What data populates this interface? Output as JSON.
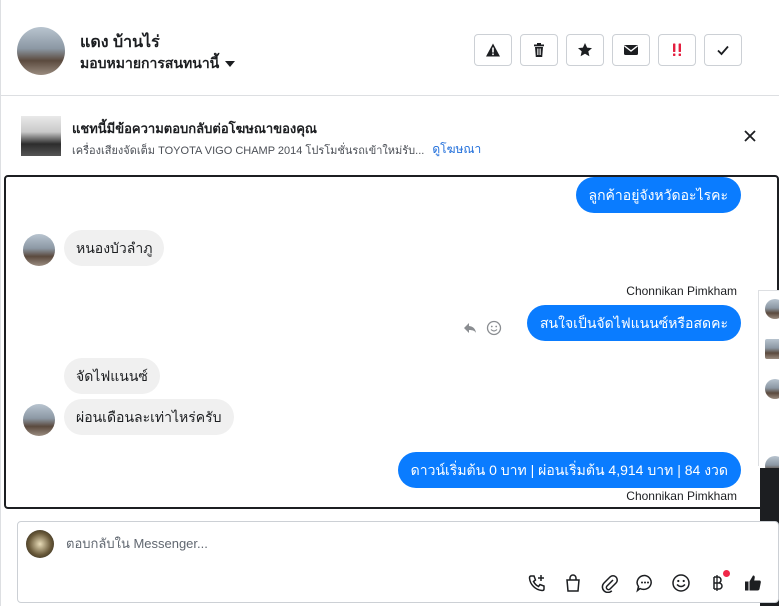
{
  "contact": {
    "name": "แดง บ้านไร่",
    "assign_label": "มอบหมายการสนทนานี้"
  },
  "header_actions": [
    {
      "icon": "warning-icon"
    },
    {
      "icon": "trash-icon"
    },
    {
      "icon": "star-icon"
    },
    {
      "icon": "envelope-icon"
    },
    {
      "icon": "double-exclamation-icon"
    },
    {
      "icon": "checkmark-icon"
    }
  ],
  "ad_banner": {
    "title": "แชทนี้มีข้อความตอบกลับต่อโฆษณาของคุณ",
    "subtitle": "เครื่องเสียงจัดเต็ม TOYOTA VIGO CHAMP 2014 โปรโมชั่นรถเข้าใหม่รับ...",
    "link": "ดูโฆษณา"
  },
  "messages": [
    {
      "direction": "out",
      "text": "ลูกค้าอยู่จังหวัดอะไรคะ"
    },
    {
      "direction": "in",
      "text": "หนองบัวลำภู"
    },
    {
      "direction": "out",
      "sender": "Chonnikan Pimkham",
      "text": "สนใจเป็นจัดไฟแนนซ์หรือสดคะ"
    },
    {
      "direction": "in",
      "text": "จัดไฟแนนซ์"
    },
    {
      "direction": "in",
      "text": "ผ่อนเดือนละเท่าไหร่ครับ"
    },
    {
      "direction": "out",
      "text": "ดาวน์เริ่มต้น 0 บาท | ผ่อนเริ่มต้น 4,914 บาท | 84 งวด",
      "sender": "Chonnikan Pimkham"
    }
  ],
  "composer": {
    "placeholder": "ตอบกลับใน Messenger..."
  },
  "composer_tools": [
    "call-add-icon",
    "shopping-bag-icon",
    "paperclip-icon",
    "chat-bubble-icon",
    "smiley-icon",
    "baht-icon",
    "thumbs-up-icon"
  ],
  "colors": {
    "outgoing_bubble": "#0a7cff",
    "incoming_bubble": "#f0f0f0",
    "link": "#216fdb",
    "notification_dot": "#f02849",
    "alert_red": "#e41e3f"
  }
}
